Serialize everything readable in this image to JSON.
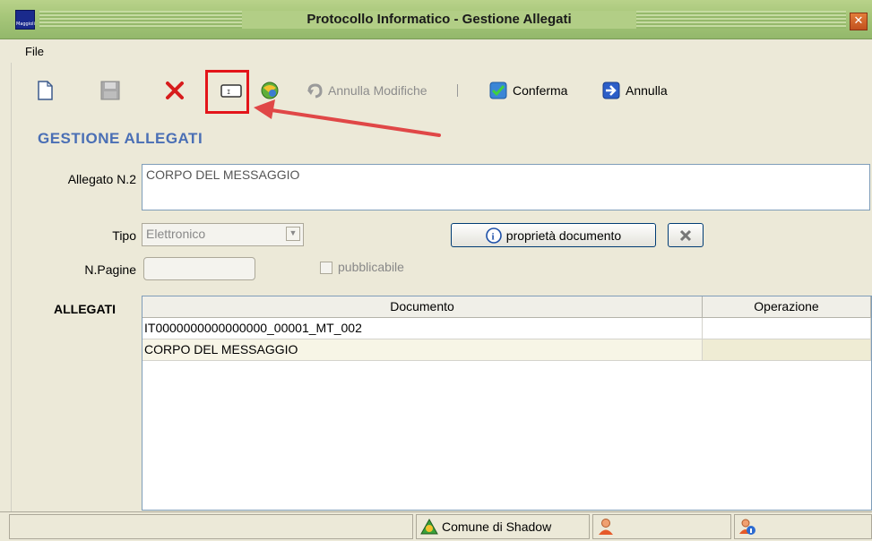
{
  "window": {
    "title": "Protocollo Informatico - Gestione Allegati",
    "app_icon_text": "Maggioli",
    "close_glyph": "✕"
  },
  "menu": {
    "file": "File"
  },
  "toolbar": {
    "new_icon": "new-document-icon",
    "save_icon": "save-icon",
    "delete_icon": "delete-icon",
    "scan_icon": "scanner-icon",
    "attach_icon": "attach-icon",
    "undo_label": "Annulla Modifiche",
    "confirm_label": "Conferma",
    "cancel_label": "Annulla",
    "separator": "|"
  },
  "section_title": "GESTIONE ALLEGATI",
  "form": {
    "allegato_label": "Allegato N.2",
    "allegato_value": "CORPO DEL MESSAGGIO",
    "tipo_label": "Tipo",
    "tipo_value": "Elettronico",
    "properties_button": "proprietà documento",
    "npagine_label": "N.Pagine",
    "npagine_value": "",
    "pubblicabile_label": "pubblicabile",
    "pubblicabile_checked": false
  },
  "attachments": {
    "label": "ALLEGATI",
    "columns": [
      "Documento",
      "Operazione"
    ],
    "rows": [
      {
        "documento": "IT0000000000000000_00001_MT_002",
        "operazione": ""
      },
      {
        "documento": "CORPO DEL MESSAGGIO",
        "operazione": ""
      }
    ]
  },
  "statusbar": {
    "comune": "Comune di Shadow"
  },
  "colors": {
    "titlebar": "#a7c77a",
    "section_title": "#4a6fb5",
    "highlight": "#e3151a",
    "selected_row": "#f7f5e6"
  }
}
